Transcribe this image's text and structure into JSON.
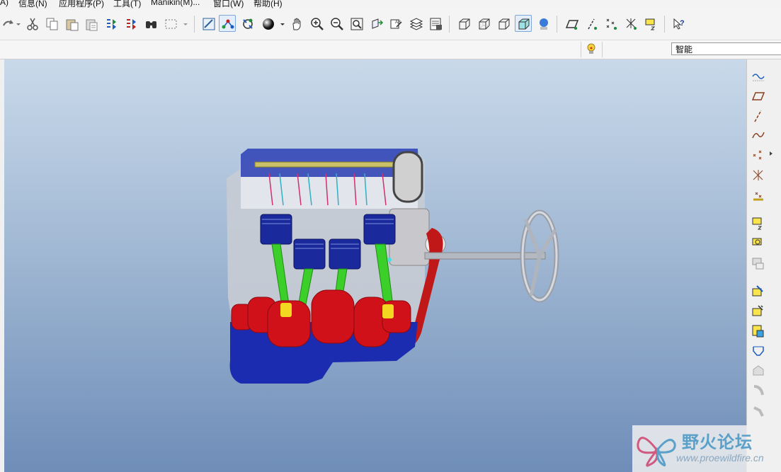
{
  "menu": {
    "items": [
      "A)",
      "信息(N)",
      "应用程序(P)",
      "工具(T)",
      "Manikin(M)...",
      "窗口(W)",
      "帮助(H)"
    ]
  },
  "toolbar": {
    "icons": [
      "redo-icon",
      "cut-icon",
      "copy-icon",
      "paste-icon",
      "paste-special-icon",
      "regenerate-icon",
      "regenerate-manager-icon",
      "find-icon",
      "select-box-icon",
      "repaint-icon",
      "spin-center-icon",
      "orient-mode-icon",
      "appearance-icon",
      "pan-icon",
      "zoom-in-icon",
      "zoom-out-icon",
      "refit-icon",
      "reorient-icon",
      "named-views-icon",
      "layers-icon",
      "view-manager-icon",
      "wireframe-icon",
      "hidden-line-icon",
      "no-hidden-icon",
      "shading-icon",
      "shading-edges-icon",
      "datum-planes-icon",
      "datum-axes-icon",
      "datum-points-icon",
      "datum-csys-icon",
      "annotations-icon",
      "whats-this-icon"
    ]
  },
  "filter": {
    "value": "智能",
    "light_icon": "light-bulb-icon"
  },
  "rightbar": {
    "icons": [
      "sketch-curve-icon",
      "datum-plane-icon",
      "datum-axis-icon",
      "curve-icon",
      "datum-point-icon",
      "csys-icon",
      "analysis-icon",
      "extrude-icon",
      "revolve-icon",
      "sweep-icon",
      "hole-icon",
      "shell-icon",
      "rib-icon",
      "draft-icon",
      "round-icon",
      "chamfer-icon",
      "edge-icon",
      "misc-icon"
    ]
  },
  "watermark": {
    "title": "野火论坛",
    "url": "www.proewildfire.cn"
  },
  "colors": {
    "viewport_top": "#c9d9ea",
    "viewport_bottom": "#6e8db8",
    "engine_blue": "#1f2fa0",
    "crank_red": "#d0111a",
    "rod_green": "#3ccf2a"
  }
}
